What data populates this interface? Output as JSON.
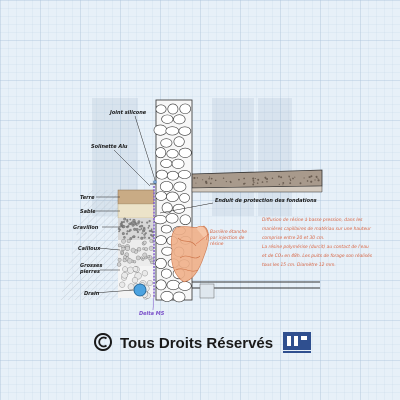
{
  "labels": {
    "joint": "Joint silicone",
    "solinette": "Solinette Alu",
    "terre": "Terre",
    "sable": "Sable",
    "gravillon": "Gravillon",
    "cailloux": "Cailloux",
    "grosses_pierres_1": "Grosses",
    "grosses_pierres_2": "pierres",
    "drain": "Drain",
    "delta": "Delta MS",
    "enduit": "Enduit de protection des fondations",
    "barriere_1": "Barrière étanche",
    "barriere_2": "par injection de",
    "barriere_3": "résine"
  },
  "note_lines": [
    "Diffusion de résine à basse pression, dans les",
    "manières capillaires de matériau sur une hauteur",
    "comprise entre 20 et 30 cm.",
    "La résine polymérise (durcit) au contact de l'eau",
    "et de CO₂ en 48h. Les puits de forage son réalisés",
    "tous les 15 cm. Diamètre 12 mm."
  ],
  "copyright": "Tous Droits Réservés",
  "colors": {
    "background": "#e7f0f8",
    "grid": "#b9cde0",
    "note": "#d9623f",
    "delta": "#7a4fc9",
    "drain": "#4da3e0",
    "resin": "#f0b089"
  },
  "icons": [
    "copyright-icon",
    "company-logo"
  ]
}
